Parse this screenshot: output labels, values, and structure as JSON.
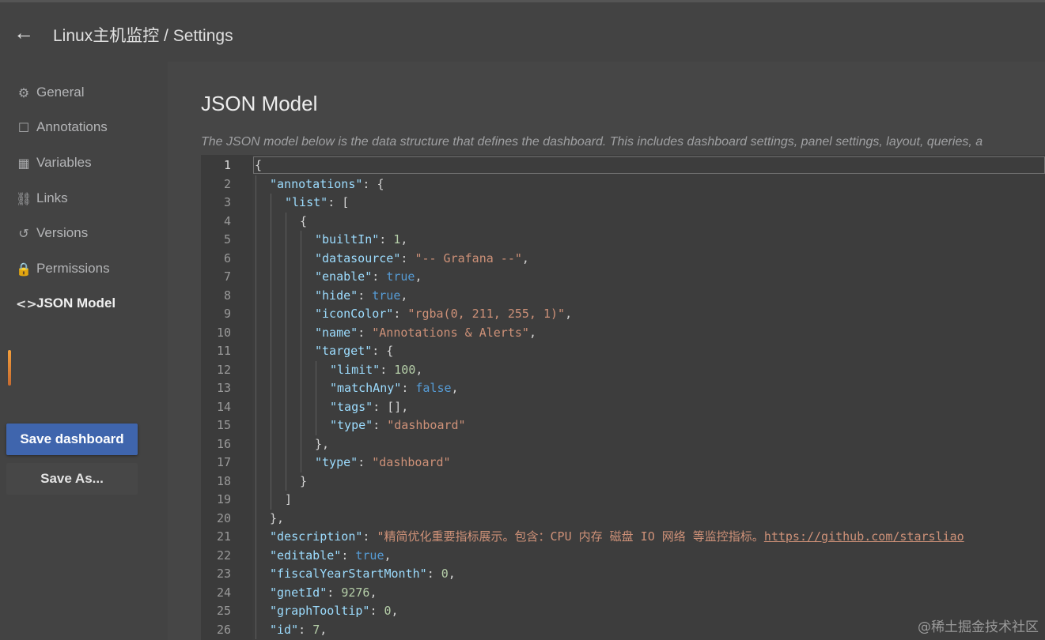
{
  "header": {
    "back_icon": "arrow-left-icon",
    "breadcrumb": "Linux主机监控 / Settings"
  },
  "sidebar": {
    "items": [
      {
        "label": "General",
        "icon": "sliders-icon",
        "glyph": "⚙"
      },
      {
        "label": "Annotations",
        "icon": "comment-icon",
        "glyph": "☐"
      },
      {
        "label": "Variables",
        "icon": "table-icon",
        "glyph": "▦"
      },
      {
        "label": "Links",
        "icon": "link-icon",
        "glyph": "⛓"
      },
      {
        "label": "Versions",
        "icon": "history-icon",
        "glyph": "↺"
      },
      {
        "label": "Permissions",
        "icon": "lock-icon",
        "glyph": "🔒"
      },
      {
        "label": "JSON Model",
        "icon": "code-icon",
        "glyph": "<>"
      }
    ],
    "active_index": 6,
    "save_label": "Save dashboard",
    "save_as_label": "Save As..."
  },
  "main": {
    "title": "JSON Model",
    "description": "The JSON model below is the data structure that defines the dashboard. This includes dashboard settings, panel settings, layout, queries, a"
  },
  "editor": {
    "current_line": 1,
    "lines": [
      {
        "n": "1",
        "indent": 0,
        "tokens": [
          [
            "p",
            "{"
          ]
        ]
      },
      {
        "n": "2",
        "indent": 1,
        "tokens": [
          [
            "k",
            "\"annotations\""
          ],
          [
            "p",
            ": {"
          ]
        ]
      },
      {
        "n": "3",
        "indent": 2,
        "tokens": [
          [
            "k",
            "\"list\""
          ],
          [
            "p",
            ": ["
          ]
        ]
      },
      {
        "n": "4",
        "indent": 3,
        "tokens": [
          [
            "p",
            "{"
          ]
        ]
      },
      {
        "n": "5",
        "indent": 4,
        "tokens": [
          [
            "k",
            "\"builtIn\""
          ],
          [
            "p",
            ": "
          ],
          [
            "n",
            "1"
          ],
          [
            "p",
            ","
          ]
        ]
      },
      {
        "n": "6",
        "indent": 4,
        "tokens": [
          [
            "k",
            "\"datasource\""
          ],
          [
            "p",
            ": "
          ],
          [
            "s",
            "\"-- Grafana --\""
          ],
          [
            "p",
            ","
          ]
        ]
      },
      {
        "n": "7",
        "indent": 4,
        "tokens": [
          [
            "k",
            "\"enable\""
          ],
          [
            "p",
            ": "
          ],
          [
            "b",
            "true"
          ],
          [
            "p",
            ","
          ]
        ]
      },
      {
        "n": "8",
        "indent": 4,
        "tokens": [
          [
            "k",
            "\"hide\""
          ],
          [
            "p",
            ": "
          ],
          [
            "b",
            "true"
          ],
          [
            "p",
            ","
          ]
        ]
      },
      {
        "n": "9",
        "indent": 4,
        "tokens": [
          [
            "k",
            "\"iconColor\""
          ],
          [
            "p",
            ": "
          ],
          [
            "s",
            "\"rgba(0, 211, 255, 1)\""
          ],
          [
            "p",
            ","
          ]
        ]
      },
      {
        "n": "10",
        "indent": 4,
        "tokens": [
          [
            "k",
            "\"name\""
          ],
          [
            "p",
            ": "
          ],
          [
            "s",
            "\"Annotations & Alerts\""
          ],
          [
            "p",
            ","
          ]
        ]
      },
      {
        "n": "11",
        "indent": 4,
        "tokens": [
          [
            "k",
            "\"target\""
          ],
          [
            "p",
            ": {"
          ]
        ]
      },
      {
        "n": "12",
        "indent": 5,
        "tokens": [
          [
            "k",
            "\"limit\""
          ],
          [
            "p",
            ": "
          ],
          [
            "n",
            "100"
          ],
          [
            "p",
            ","
          ]
        ]
      },
      {
        "n": "13",
        "indent": 5,
        "tokens": [
          [
            "k",
            "\"matchAny\""
          ],
          [
            "p",
            ": "
          ],
          [
            "b",
            "false"
          ],
          [
            "p",
            ","
          ]
        ]
      },
      {
        "n": "14",
        "indent": 5,
        "tokens": [
          [
            "k",
            "\"tags\""
          ],
          [
            "p",
            ": [],"
          ]
        ]
      },
      {
        "n": "15",
        "indent": 5,
        "tokens": [
          [
            "k",
            "\"type\""
          ],
          [
            "p",
            ": "
          ],
          [
            "s",
            "\"dashboard\""
          ]
        ]
      },
      {
        "n": "16",
        "indent": 4,
        "tokens": [
          [
            "p",
            "},"
          ]
        ]
      },
      {
        "n": "17",
        "indent": 4,
        "tokens": [
          [
            "k",
            "\"type\""
          ],
          [
            "p",
            ": "
          ],
          [
            "s",
            "\"dashboard\""
          ]
        ]
      },
      {
        "n": "18",
        "indent": 3,
        "tokens": [
          [
            "p",
            "}"
          ]
        ]
      },
      {
        "n": "19",
        "indent": 2,
        "tokens": [
          [
            "p",
            "]"
          ]
        ]
      },
      {
        "n": "20",
        "indent": 1,
        "tokens": [
          [
            "p",
            "},"
          ]
        ]
      },
      {
        "n": "21",
        "indent": 1,
        "tokens": [
          [
            "k",
            "\"description\""
          ],
          [
            "p",
            ": "
          ],
          [
            "s",
            "\"精简优化重要指标展示。包含：CPU 内存 磁盘 IO 网络 等监控指标。"
          ],
          [
            "u",
            "https://github.com/starsliao"
          ]
        ]
      },
      {
        "n": "22",
        "indent": 1,
        "tokens": [
          [
            "k",
            "\"editable\""
          ],
          [
            "p",
            ": "
          ],
          [
            "b",
            "true"
          ],
          [
            "p",
            ","
          ]
        ]
      },
      {
        "n": "23",
        "indent": 1,
        "tokens": [
          [
            "k",
            "\"fiscalYearStartMonth\""
          ],
          [
            "p",
            ": "
          ],
          [
            "n",
            "0"
          ],
          [
            "p",
            ","
          ]
        ]
      },
      {
        "n": "24",
        "indent": 1,
        "tokens": [
          [
            "k",
            "\"gnetId\""
          ],
          [
            "p",
            ": "
          ],
          [
            "n",
            "9276"
          ],
          [
            "p",
            ","
          ]
        ]
      },
      {
        "n": "25",
        "indent": 1,
        "tokens": [
          [
            "k",
            "\"graphTooltip\""
          ],
          [
            "p",
            ": "
          ],
          [
            "n",
            "0"
          ],
          [
            "p",
            ","
          ]
        ]
      },
      {
        "n": "26",
        "indent": 1,
        "tokens": [
          [
            "k",
            "\"id\""
          ],
          [
            "p",
            ": "
          ],
          [
            "n",
            "7"
          ],
          [
            "p",
            ","
          ]
        ]
      }
    ]
  },
  "watermark": "@稀土掘金技术社区"
}
